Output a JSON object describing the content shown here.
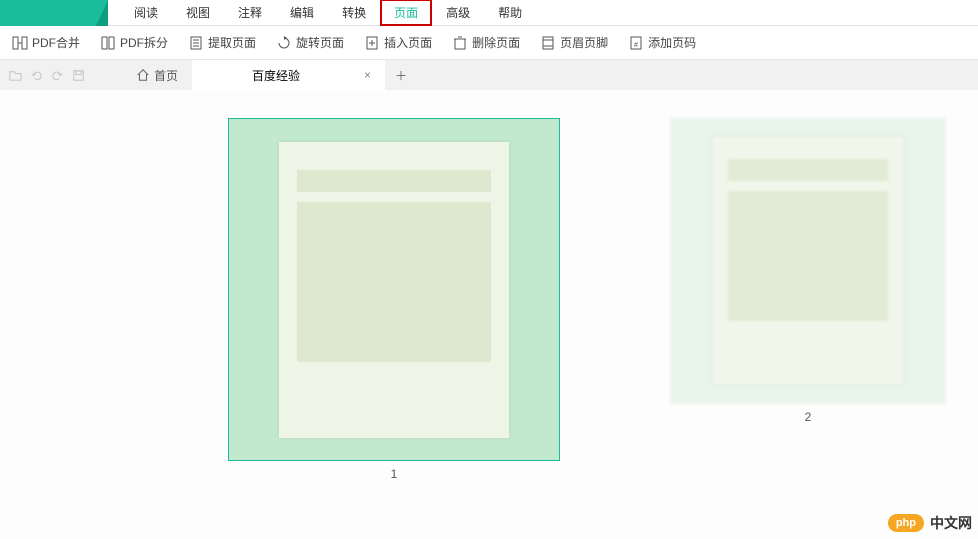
{
  "menubar": {
    "items": [
      {
        "label": "阅读"
      },
      {
        "label": "视图"
      },
      {
        "label": "注释"
      },
      {
        "label": "编辑"
      },
      {
        "label": "转换"
      },
      {
        "label": "页面",
        "active": true
      },
      {
        "label": "高级"
      },
      {
        "label": "帮助"
      }
    ]
  },
  "toolbar": {
    "pdf_merge": "PDF合并",
    "pdf_split": "PDF拆分",
    "extract_page": "提取页面",
    "rotate_page": "旋转页面",
    "insert_page": "插入页面",
    "delete_page": "删除页面",
    "header_footer": "页眉页脚",
    "add_pagenum": "添加页码"
  },
  "tabs": {
    "home": "首页",
    "doc_title": "百度经验",
    "close": "×",
    "add": "＋"
  },
  "pages": [
    {
      "num": "1",
      "selected": true
    },
    {
      "num": "2",
      "selected": false
    }
  ],
  "watermark": {
    "badge": "php",
    "text": "中文网"
  }
}
